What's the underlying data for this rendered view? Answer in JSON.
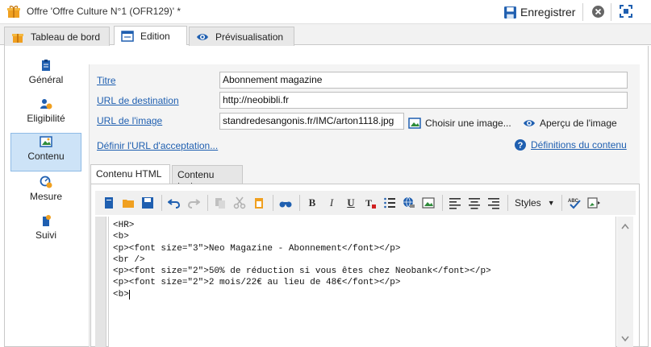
{
  "window": {
    "title": "Offre 'Offre Culture N°1 (OFR129)' *",
    "save_label": "Enregistrer"
  },
  "tabs": [
    {
      "label": "Tableau de bord",
      "icon": "gift-icon"
    },
    {
      "label": "Edition",
      "icon": "edit-window-icon",
      "active": true
    },
    {
      "label": "Prévisualisation",
      "icon": "eye-icon"
    }
  ],
  "nav": [
    {
      "label": "Général",
      "icon": "clipboard-icon"
    },
    {
      "label": "Eligibilité",
      "icon": "users-icon"
    },
    {
      "label": "Contenu",
      "icon": "image-icon",
      "active": true
    },
    {
      "label": "Mesure",
      "icon": "gauge-icon"
    },
    {
      "label": "Suivi",
      "icon": "tracking-icon"
    }
  ],
  "form": {
    "titre_label": "Titre",
    "titre_value": "Abonnement magazine",
    "url_dest_label": "URL de destination",
    "url_dest_value": "http://neobibli.fr",
    "url_image_label": "URL de l'image",
    "url_image_value": "standredesangonis.fr/IMC/arton1118.jpg",
    "choose_image": "Choisir une image...",
    "preview_image": "Aperçu de l'image",
    "define_url": "Définir l'URL d'acceptation...",
    "content_defs": "Définitions du contenu"
  },
  "subtabs": [
    {
      "label": "Contenu HTML",
      "active": true
    },
    {
      "label": "Contenu texte"
    }
  ],
  "editor": {
    "styles_label": "Styles",
    "code_lines": [
      "<HR>",
      "<b>",
      "<p><font size=\"3\">Neo Magazine - Abonnement</font></p>",
      "<br />",
      "<p><font size=\"2\">50% de réduction si vous êtes chez Neobank</font></p>",
      "<p><font size=\"2\">2 mois/22€ au lieu de 48€</font></p>",
      "<b>"
    ]
  },
  "colors": {
    "accent": "#1f5fb0",
    "active_nav_bg": "#cde3f7",
    "gift_orange": "#f0a020"
  }
}
